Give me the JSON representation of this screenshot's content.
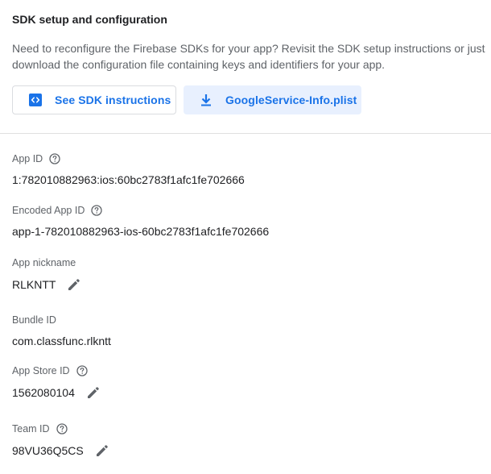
{
  "sdk": {
    "title": "SDK setup and configuration",
    "description": "Need to reconfigure the Firebase SDKs for your app? Revisit the SDK setup instructions or just download the configuration file containing keys and identifiers for your app.",
    "buttons": {
      "instructions_label": "See SDK instructions",
      "download_label": "GoogleService-Info.plist"
    }
  },
  "fields": {
    "app_id": {
      "label": "App ID",
      "value": "1:782010882963:ios:60bc2783f1afc1fe702666"
    },
    "encoded_app_id": {
      "label": "Encoded App ID",
      "value": "app-1-782010882963-ios-60bc2783f1afc1fe702666"
    },
    "app_nickname": {
      "label": "App nickname",
      "value": "RLKNTT"
    },
    "bundle_id": {
      "label": "Bundle ID",
      "value": "com.classfunc.rlkntt"
    },
    "app_store_id": {
      "label": "App Store ID",
      "value": "1562080104"
    },
    "team_id": {
      "label": "Team ID",
      "value": "98VU36Q5CS"
    }
  },
  "icons": {
    "code": "code-icon",
    "download": "download-icon",
    "help": "help-circle-icon",
    "edit": "pencil-icon"
  },
  "colors": {
    "accent": "#1a73e8",
    "accent_bg": "#e8f0fe",
    "muted_text": "#5f6368",
    "icon_gray": "#5f6368"
  }
}
